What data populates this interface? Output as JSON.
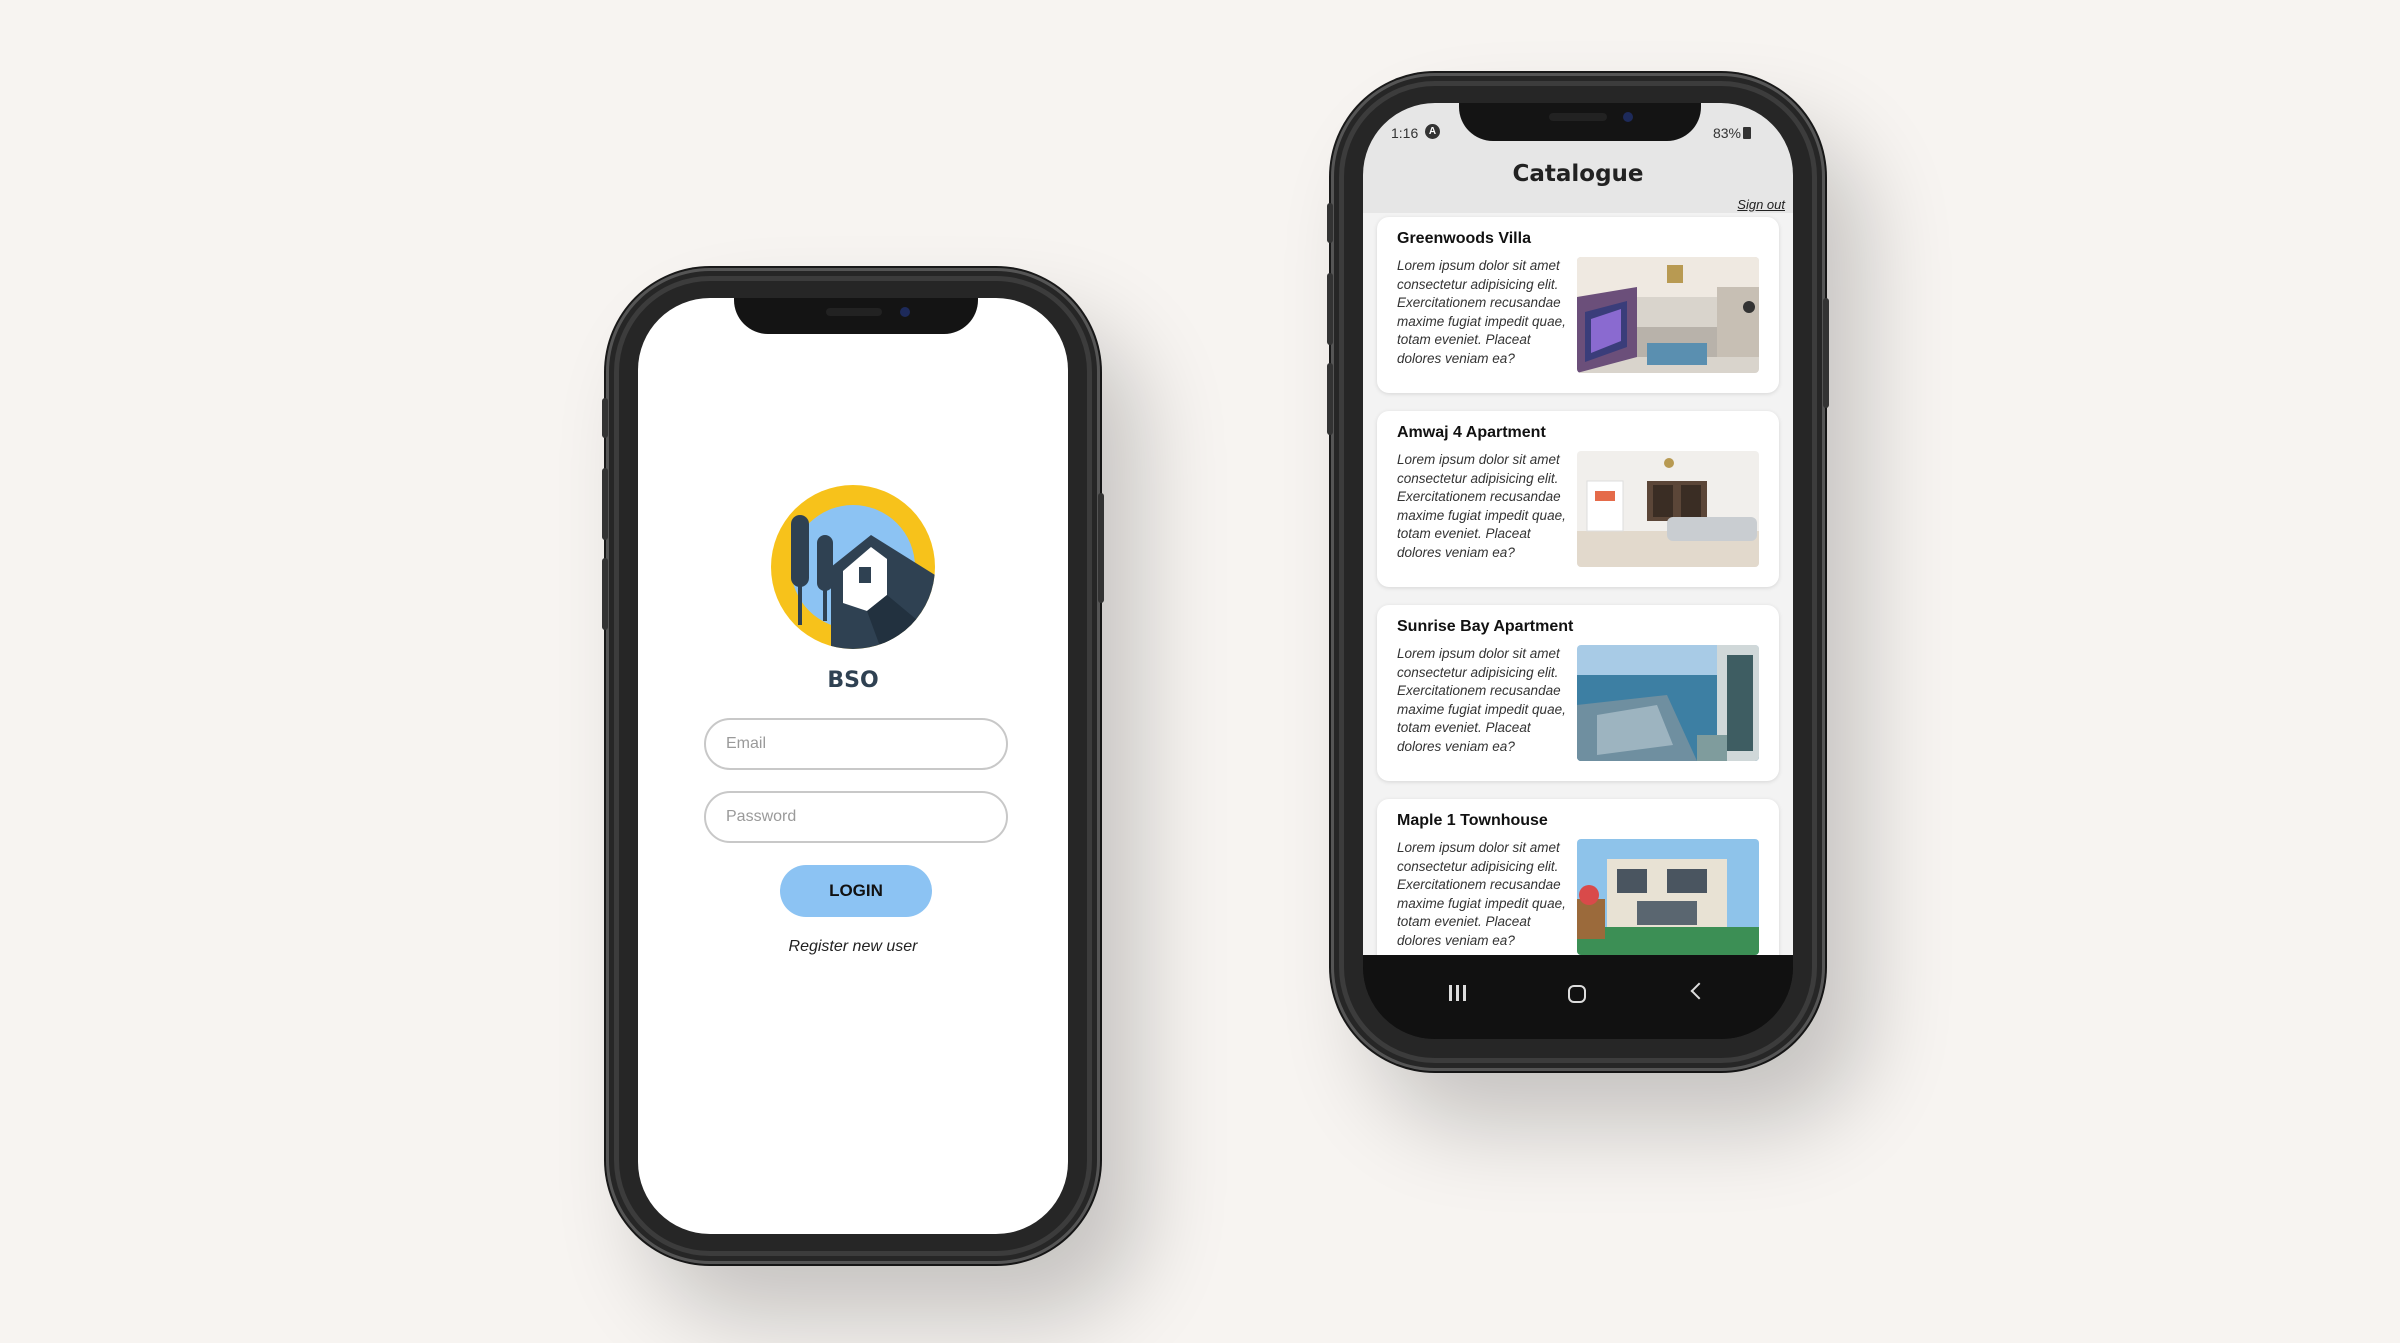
{
  "login_screen": {
    "brand": "BSO",
    "email_placeholder": "Email",
    "password_placeholder": "Password",
    "login_label": "LOGIN",
    "register_link": "Register new user",
    "colors": {
      "logo_yellow": "#f7c21b",
      "logo_sky": "#8cc3f3",
      "logo_dark": "#2f4152",
      "button": "#8cc3f3"
    }
  },
  "catalogue_screen": {
    "status_time": "1:16",
    "status_a_icon": "A",
    "status_battery": "83%",
    "title": "Catalogue",
    "sign_out": "Sign out",
    "listings": [
      {
        "title": "Greenwoods Villa",
        "description": "Lorem ipsum dolor sit amet consectetur adipisicing elit. Exercitationem recusandae maxime fugiat impedit quae, totam eveniet. Placeat dolores veniam ea?",
        "image": "living-room-photo"
      },
      {
        "title": "Amwaj 4 Apartment",
        "description": "Lorem ipsum dolor sit amet consectetur adipisicing elit. Exercitationem recusandae maxime fugiat impedit quae, totam eveniet. Placeat dolores veniam ea?",
        "image": "white-living-room-photo"
      },
      {
        "title": "Sunrise Bay Apartment",
        "description": "Lorem ipsum dolor sit amet consectetur adipisicing elit. Exercitationem recusandae maxime fugiat impedit quae, totam eveniet. Placeat dolores veniam ea?",
        "image": "sea-view-balcony-photo"
      },
      {
        "title": "Maple 1 Townhouse",
        "description": "Lorem ipsum dolor sit amet consectetur adipisicing elit. Exercitationem recusandae maxime fugiat impedit quae, totam eveniet. Placeat dolores veniam ea?",
        "image": "townhouse-exterior-photo"
      }
    ],
    "nav": {
      "recent": "recent-apps-icon",
      "home": "home-icon",
      "back": "back-icon"
    }
  }
}
